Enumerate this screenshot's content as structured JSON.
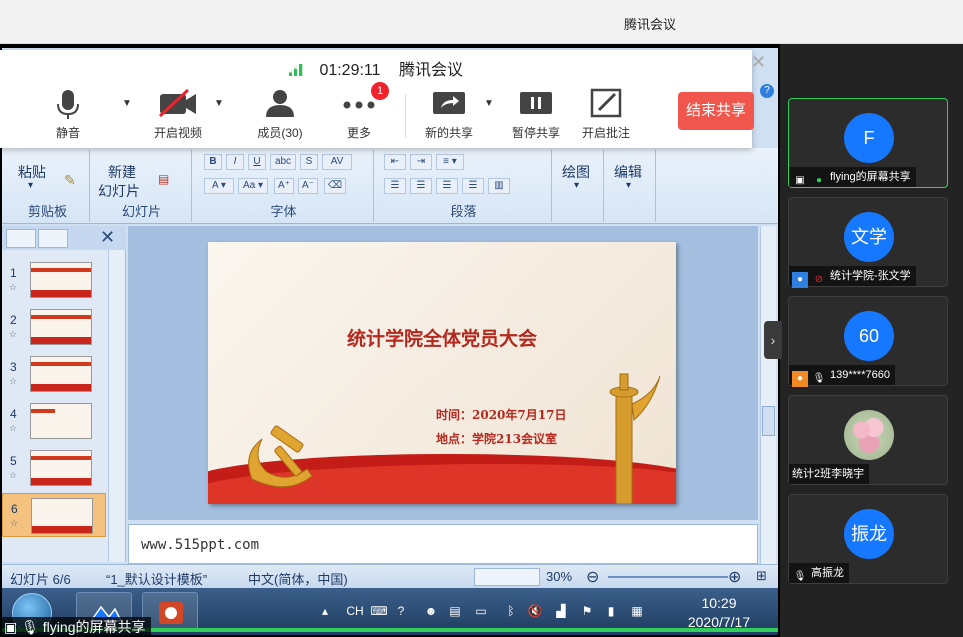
{
  "app": {
    "title": "腾讯会议"
  },
  "meeting_bar": {
    "timer": "01:29:11",
    "name": "腾讯会议",
    "mute": "静音",
    "video": "开启视频",
    "members": "成员(30)",
    "more": "更多",
    "more_badge": "1",
    "new_share": "新的共享",
    "pause_share": "暂停共享",
    "annotate": "开启批注",
    "end_share": "结束共享"
  },
  "ribbon": {
    "paste": "粘贴",
    "new_slide_l1": "新建",
    "new_slide_l2": "幻灯片",
    "draw": "绘图",
    "edit": "编辑",
    "groups": {
      "clipboard": "剪贴板",
      "slides": "幻灯片",
      "font": "字体",
      "paragraph": "段落"
    }
  },
  "slides_panel": {
    "items": [
      {
        "num": "1"
      },
      {
        "num": "2"
      },
      {
        "num": "3"
      },
      {
        "num": "4"
      },
      {
        "num": "5"
      },
      {
        "num": "6"
      }
    ],
    "selected": 6
  },
  "slide": {
    "title": "统计学院全体党员大会",
    "time_line": "时间：2020年7月17日",
    "place_line": "地点：学院213会议室"
  },
  "notes": {
    "text": "www.515ppt.com"
  },
  "statusbar": {
    "slide_count": "幻灯片 6/6",
    "theme": "“1_默认设计模板”",
    "language": "中文(简体，中国)",
    "zoom": "30%"
  },
  "taskbar": {
    "ime": "CH",
    "time": "10:29",
    "date": "2020/7/17"
  },
  "share_label": "flying的屏幕共享",
  "participants": [
    {
      "avatar_text": "F",
      "name": "flying的屏幕共享",
      "active": true
    },
    {
      "avatar_text": "文学",
      "name": "统计学院-张文学",
      "active": false
    },
    {
      "avatar_text": "60",
      "name": "139****7660",
      "active": false
    },
    {
      "avatar_text": "",
      "name": "统计2班李晓宇",
      "active": false
    },
    {
      "avatar_text": "振龙",
      "name": "高振龙",
      "active": false
    }
  ],
  "colors": {
    "accent": "#1677ff",
    "end_share": "#f0564b",
    "active_border": "#2fcf5a",
    "slide_red": "#b5281d"
  }
}
